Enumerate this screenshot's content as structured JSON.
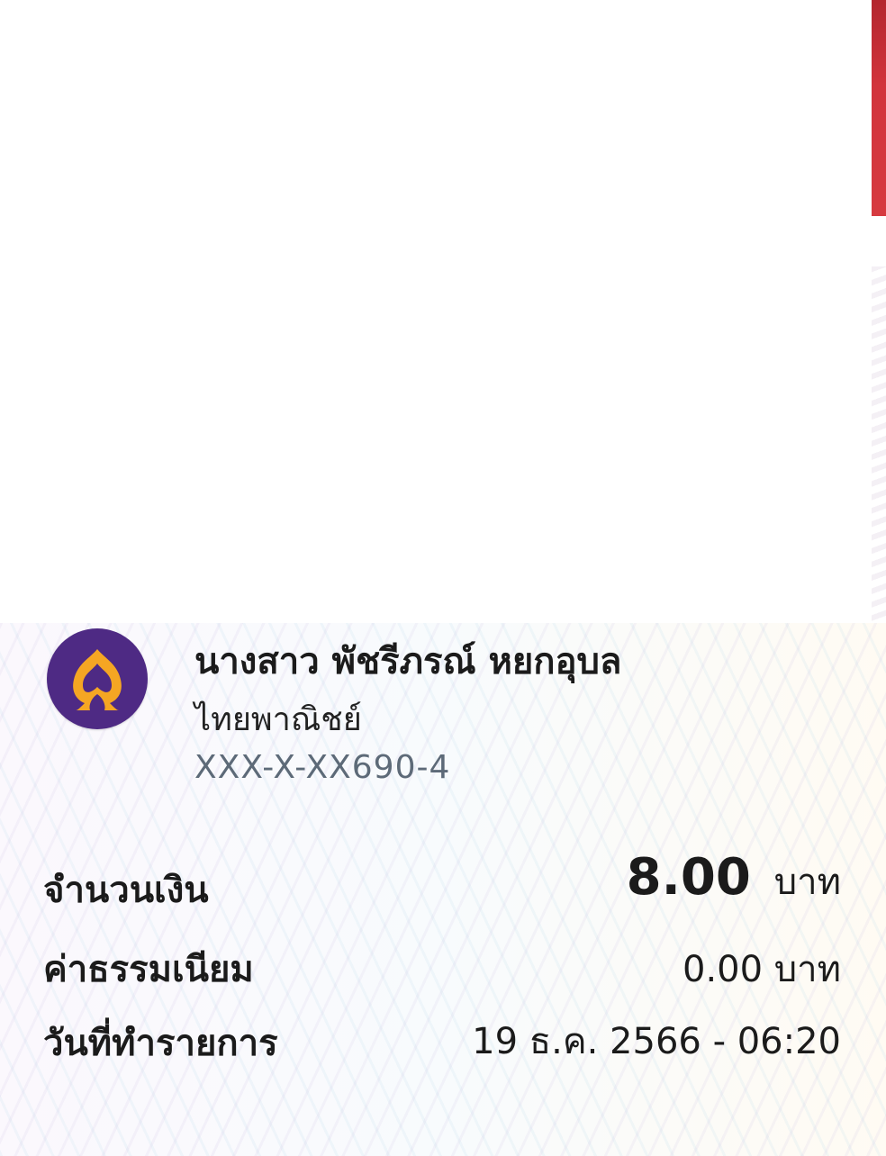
{
  "receipt": {
    "recipient_name": "นางสาว พัชรีภรณ์ หยกอุบล",
    "bank_name": "ไทยพาณิชย์",
    "account_number": "XXX-X-XX690-4",
    "bank_logo_icon": "scb-bodhi-leaf-icon",
    "bank_color": "#4e2a84",
    "logo_color": "#f5a623",
    "accent_color": "#d2343c"
  },
  "details": {
    "amount_label": "จำนวนเงิน",
    "amount_value": "8.00",
    "amount_unit": "บาท",
    "fee_label": "ค่าธรรมเนียม",
    "fee_value": "0.00 บาท",
    "date_label": "วันที่ทำรายการ",
    "date_value": "19 ธ.ค. 2566 - 06:20"
  }
}
